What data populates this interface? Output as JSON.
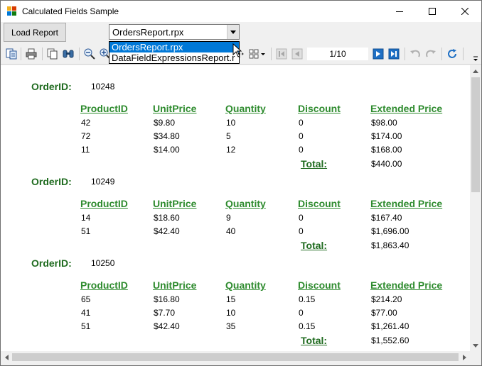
{
  "window": {
    "title": "Calculated Fields Sample"
  },
  "commands": {
    "load_report_label": "Load Report",
    "report_combo_value": "OrdersReport.rpx",
    "report_options": [
      "OrdersReport.rpx",
      "DataFieldExpressionsReport.r"
    ]
  },
  "toolbar": {
    "page_indicator": "1/10"
  },
  "report": {
    "order_label": "OrderID:",
    "total_label": "Total:",
    "columns": [
      "ProductID",
      "UnitPrice",
      "Quantity",
      "Discount",
      "Extended Price"
    ],
    "orders": [
      {
        "id": "10248",
        "rows": [
          [
            "42",
            "$9.80",
            "10",
            "0",
            "$98.00"
          ],
          [
            "72",
            "$34.80",
            "5",
            "0",
            "$174.00"
          ],
          [
            "11",
            "$14.00",
            "12",
            "0",
            "$168.00"
          ]
        ],
        "total": "$440.00"
      },
      {
        "id": "10249",
        "rows": [
          [
            "14",
            "$18.60",
            "9",
            "0",
            "$167.40"
          ],
          [
            "51",
            "$42.40",
            "40",
            "0",
            "$1,696.00"
          ]
        ],
        "total": "$1,863.40"
      },
      {
        "id": "10250",
        "rows": [
          [
            "65",
            "$16.80",
            "15",
            "0.15",
            "$214.20"
          ],
          [
            "41",
            "$7.70",
            "10",
            "0",
            "$77.00"
          ],
          [
            "51",
            "$42.40",
            "35",
            "0.15",
            "$1,261.40"
          ]
        ],
        "total": "$1,552.60"
      }
    ]
  },
  "colors": {
    "heading_green": "#2e8b2e",
    "label_green": "#1f6b1f",
    "selection_blue": "#0078d7"
  },
  "icons": [
    "app-icon",
    "minimize-icon",
    "maximize-icon",
    "close-icon",
    "combo-arrow-icon",
    "toc-icon",
    "print-icon",
    "copy-icon",
    "find-icon",
    "zoom-out-icon",
    "zoom-in-icon",
    "pan-icon",
    "multipage-icon",
    "first-page-icon",
    "previous-page-icon",
    "next-page-icon",
    "last-page-icon",
    "back-icon",
    "forward-icon",
    "refresh-icon",
    "toolbar-overflow-icon"
  ]
}
